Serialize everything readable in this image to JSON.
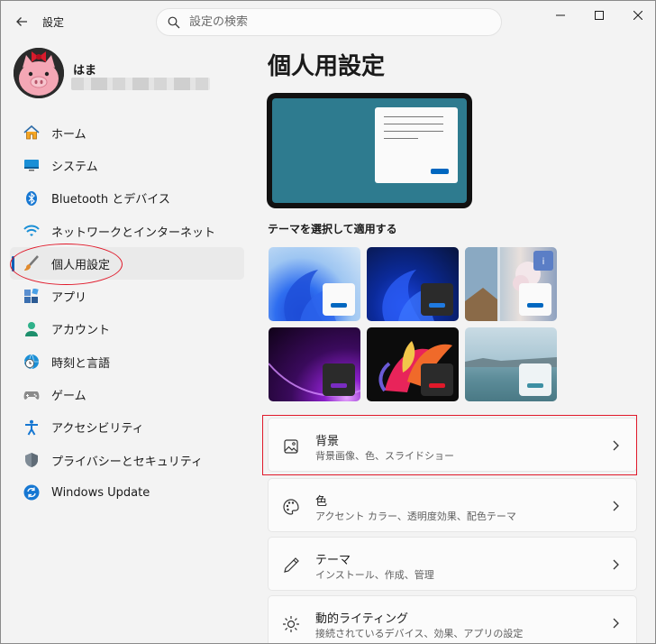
{
  "window": {
    "title": "設定"
  },
  "search": {
    "placeholder": "設定の検索"
  },
  "profile": {
    "name": "はま"
  },
  "nav": {
    "items": [
      {
        "label": "ホーム",
        "icon": "home-icon"
      },
      {
        "label": "システム",
        "icon": "monitor-icon"
      },
      {
        "label": "Bluetooth とデバイス",
        "icon": "bluetooth-icon"
      },
      {
        "label": "ネットワークとインターネット",
        "icon": "wifi-icon"
      },
      {
        "label": "個人用設定",
        "icon": "paintbrush-icon",
        "active": true
      },
      {
        "label": "アプリ",
        "icon": "apps-icon"
      },
      {
        "label": "アカウント",
        "icon": "person-icon"
      },
      {
        "label": "時刻と言語",
        "icon": "clock-globe-icon"
      },
      {
        "label": "ゲーム",
        "icon": "gamepad-icon"
      },
      {
        "label": "アクセシビリティ",
        "icon": "accessibility-icon"
      },
      {
        "label": "プライバシーとセキュリティ",
        "icon": "shield-icon"
      },
      {
        "label": "Windows Update",
        "icon": "update-icon"
      }
    ]
  },
  "main": {
    "title": "個人用設定",
    "themes_label": "テーマを選択して適用する",
    "cards": [
      {
        "title": "背景",
        "subtitle": "背景画像、色、スライドショー",
        "icon": "image-icon"
      },
      {
        "title": "色",
        "subtitle": "アクセント カラー、透明度効果、配色テーマ",
        "icon": "palette-icon"
      },
      {
        "title": "テーマ",
        "subtitle": "インストール、作成、管理",
        "icon": "pen-icon"
      },
      {
        "title": "動的ライティング",
        "subtitle": "接続されているデバイス、効果、アプリの設定",
        "icon": "sun-icon"
      }
    ]
  },
  "colors": {
    "accent": "#005fb8",
    "annotation_red": "#e0192a",
    "preview_bg": "#2e7b8f"
  }
}
